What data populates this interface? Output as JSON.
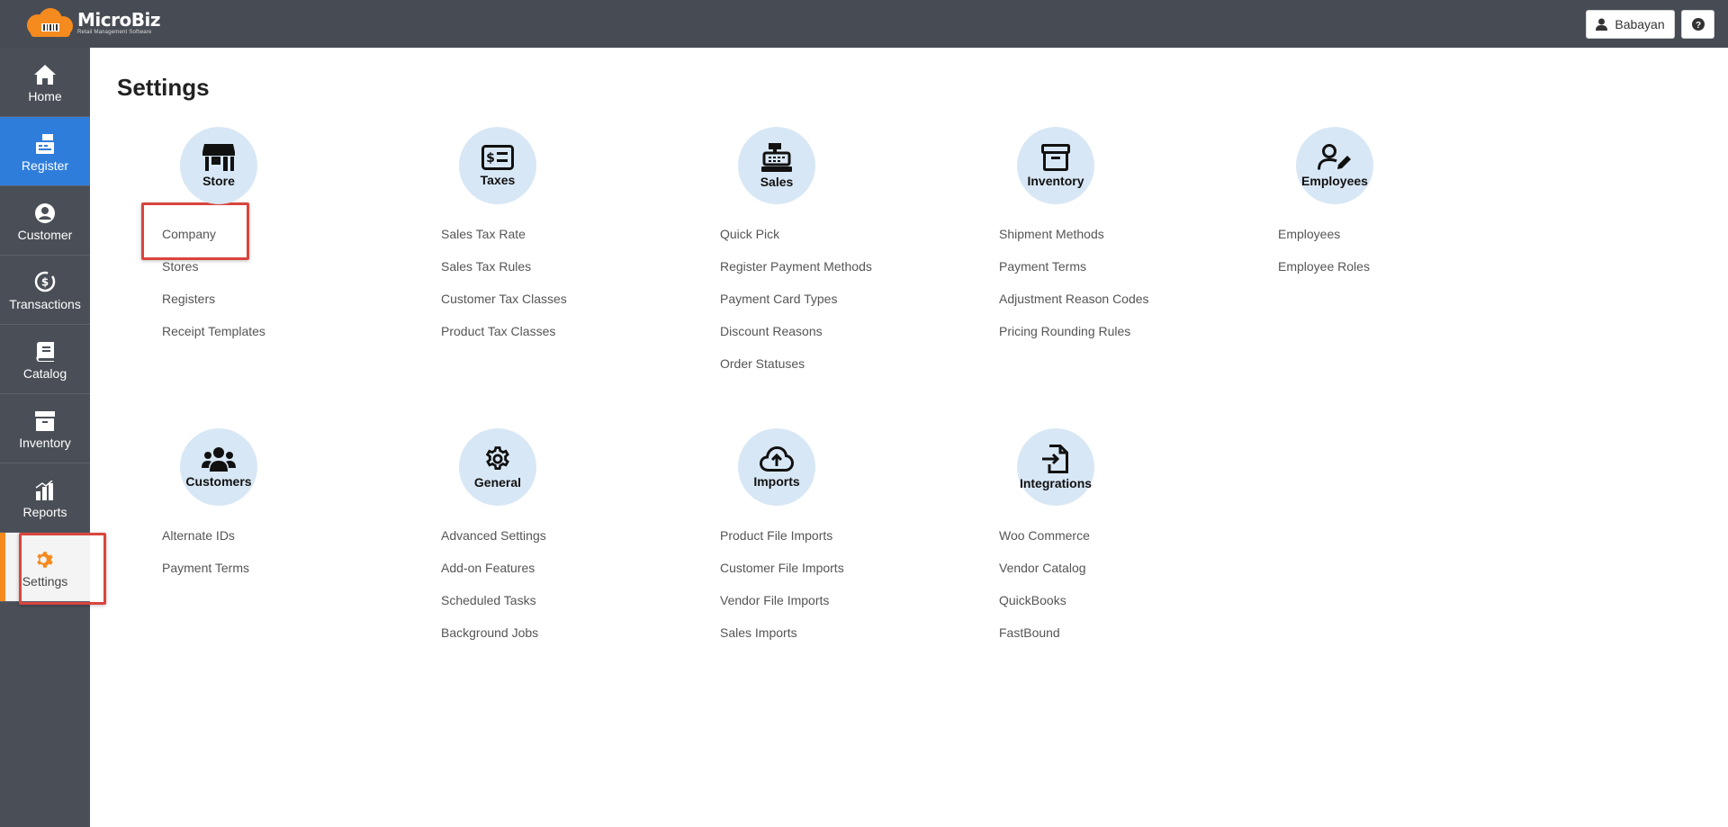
{
  "header": {
    "logo_title": "MicroBiz",
    "logo_subtitle": "Retail Management Software",
    "user_name": "Babayan",
    "help_symbol": "?"
  },
  "sidebar": {
    "items": [
      {
        "label": "Home",
        "icon": "home-icon"
      },
      {
        "label": "Register",
        "icon": "register-icon"
      },
      {
        "label": "Customer",
        "icon": "customer-icon"
      },
      {
        "label": "Transactions",
        "icon": "transactions-icon"
      },
      {
        "label": "Catalog",
        "icon": "catalog-icon"
      },
      {
        "label": "Inventory",
        "icon": "inventory-icon"
      },
      {
        "label": "Reports",
        "icon": "reports-icon"
      },
      {
        "label": "Settings",
        "icon": "settings-icon"
      }
    ],
    "active_item": "Register",
    "selected_item": "Settings"
  },
  "colors": {
    "topbar": "#474c54",
    "sidebar": "#4a4f57",
    "active_blue": "#2f7ddb",
    "accent_orange": "#f58a1f",
    "circle": "#d8e7f5",
    "highlight_red": "#d9453e"
  },
  "page": {
    "title": "Settings"
  },
  "sections": [
    {
      "name": "Store",
      "icon": "store-icon",
      "links": [
        "Company",
        "Stores",
        "Registers",
        "Receipt Templates"
      ]
    },
    {
      "name": "Taxes",
      "icon": "taxes-icon",
      "links": [
        "Sales Tax Rate",
        "Sales Tax Rules",
        "Customer Tax Classes",
        "Product Tax Classes"
      ]
    },
    {
      "name": "Sales",
      "icon": "cash-register-icon",
      "links": [
        "Quick Pick",
        "Register Payment Methods",
        "Payment Card Types",
        "Discount Reasons",
        "Order Statuses"
      ]
    },
    {
      "name": "Inventory",
      "icon": "archive-box-icon",
      "links": [
        "Shipment Methods",
        "Payment Terms",
        "Adjustment Reason Codes",
        "Pricing Rounding Rules"
      ]
    },
    {
      "name": "Employees",
      "icon": "user-edit-icon",
      "links": [
        "Employees",
        "Employee Roles"
      ]
    },
    {
      "name": "Customers",
      "icon": "users-icon",
      "links": [
        "Alternate IDs",
        "Payment Terms"
      ]
    },
    {
      "name": "General",
      "icon": "gear-icon",
      "links": [
        "Advanced Settings",
        "Add-on Features",
        "Scheduled Tasks",
        "Background Jobs"
      ]
    },
    {
      "name": "Imports",
      "icon": "cloud-upload-icon",
      "links": [
        "Product File Imports",
        "Customer File Imports",
        "Vendor File Imports",
        "Sales Imports"
      ]
    },
    {
      "name": "Integrations",
      "icon": "file-import-icon",
      "links": [
        "Woo Commerce",
        "Vendor Catalog",
        "QuickBooks",
        "FastBound"
      ]
    }
  ]
}
